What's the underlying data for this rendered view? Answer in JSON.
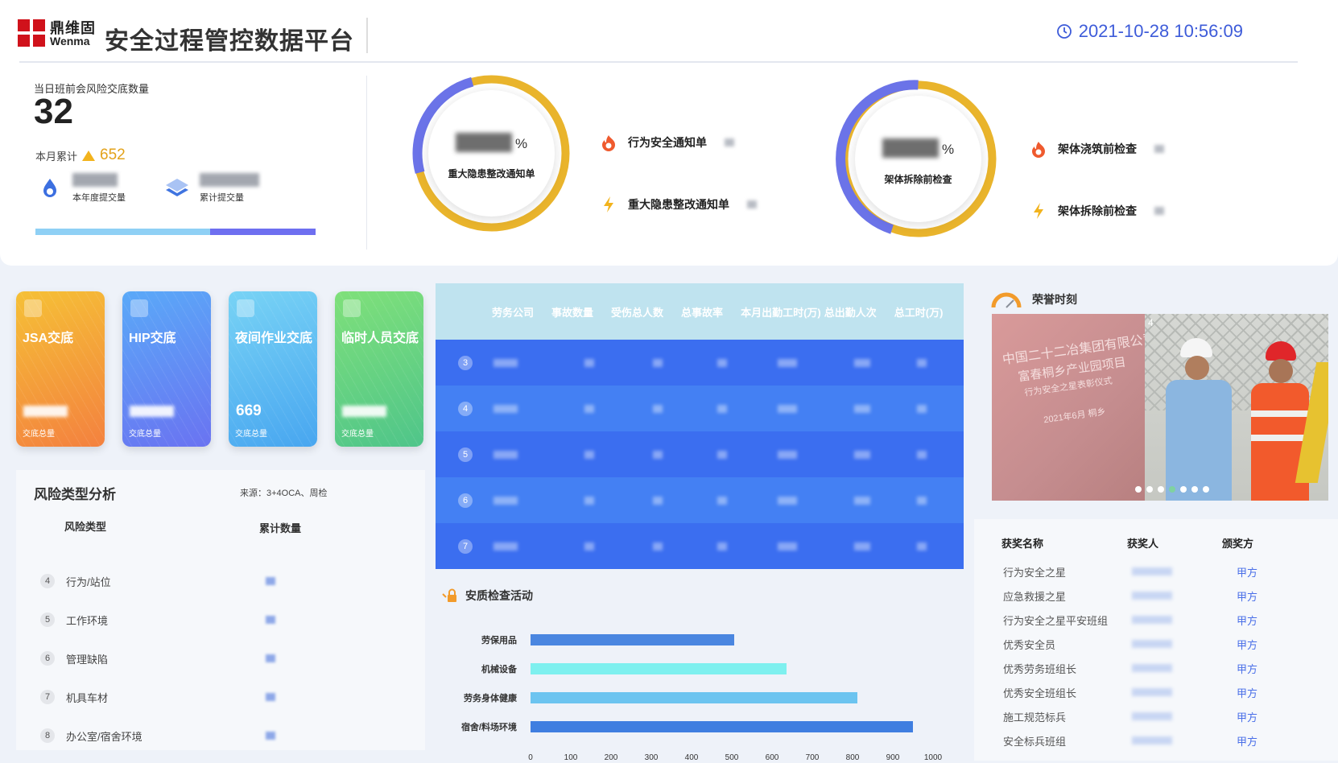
{
  "header": {
    "logo_cn": "鼎维固",
    "logo_en": "Wenma",
    "title": "安全过程管控数据平台",
    "datetime": "2021-10-28 10:56:09"
  },
  "kpi": {
    "label": "当日班前会风险交底数量",
    "value": "32",
    "month_label": "本月累计",
    "month_value": "652",
    "year_label": "本年度提交量",
    "total_label": "累计提交量"
  },
  "rings": [
    {
      "label": "重大隐患整改通知单",
      "unit": "%",
      "items": [
        "行为安全通知单",
        "重大隐患整改通知单"
      ]
    },
    {
      "label": "架体拆除前检查",
      "unit": "%",
      "items": [
        "架体浇筑前检查",
        "架体拆除前检查"
      ]
    }
  ],
  "cards": [
    {
      "label": "JSA交底",
      "sub": "交底总量",
      "color1": "#f5c036",
      "color2": "#f4813f"
    },
    {
      "label": "HIP交底",
      "sub": "交底总量",
      "color1": "#5aa9f8",
      "color2": "#6a73f1"
    },
    {
      "label": "夜间作业交底",
      "sub": "交底总量",
      "color1": "#78d3f5",
      "color2": "#48a6f0",
      "value": "669"
    },
    {
      "label": "临时人员交底",
      "sub": "交底总量",
      "color1": "#7fe07a",
      "color2": "#4fc58a"
    }
  ],
  "risk": {
    "title": "风险类型分析",
    "source": "来源：3+4OCA、周检",
    "col1": "风险类型",
    "col2": "累计数量",
    "rows": [
      {
        "n": "4",
        "name": "行为/站位"
      },
      {
        "n": "5",
        "name": "工作环境"
      },
      {
        "n": "6",
        "name": "管理缺陷"
      },
      {
        "n": "7",
        "name": "机具车材"
      },
      {
        "n": "8",
        "name": "办公室/宿舍环境"
      }
    ]
  },
  "table": {
    "headers": [
      "劳务公司",
      "事故数量",
      "受伤总人数",
      "总事故率",
      "本月出勤工时(万)",
      "总出勤人次",
      "总工时(万)"
    ],
    "rows": [
      "3",
      "4",
      "5",
      "6",
      "7"
    ]
  },
  "activity": {
    "title": "安质检查活动"
  },
  "chart_data": {
    "type": "bar",
    "orientation": "horizontal",
    "categories": [
      "劳保用品",
      "机械设备",
      "劳务身体健康",
      "宿舍/料场环境"
    ],
    "values": [
      505,
      636,
      812,
      950
    ],
    "xlim": [
      0,
      1000
    ],
    "ticks": [
      "0",
      "100",
      "200",
      "300",
      "400",
      "500",
      "600",
      "700",
      "800",
      "900",
      "1000"
    ],
    "colors": [
      "#4a86e0",
      "#7ef0ef",
      "#6cc4f0",
      "#3f7ee0"
    ]
  },
  "honor": {
    "title": "荣誉时刻",
    "photo_line1": "中国二十二冶集团有限公司",
    "photo_line2": "富春桐乡产业园项目",
    "photo_line3": "行为安全之星表彰仪式",
    "photo_line4": "2021年6月 桐乡",
    "photo_index": "4"
  },
  "awards": {
    "h1": "获奖名称",
    "h2": "获奖人",
    "h3": "颁奖方",
    "rows": [
      {
        "name": "行为安全之星",
        "giver": "甲方"
      },
      {
        "name": "应急救援之星",
        "giver": "甲方"
      },
      {
        "name": "行为安全之星平安班组",
        "giver": "甲方"
      },
      {
        "name": "优秀安全员",
        "giver": "甲方"
      },
      {
        "name": "优秀劳务班组长",
        "giver": "甲方"
      },
      {
        "name": "优秀安全班组长",
        "giver": "甲方"
      },
      {
        "name": "施工规范标兵",
        "giver": "甲方"
      },
      {
        "name": "安全标兵班组",
        "giver": "甲方"
      }
    ]
  }
}
